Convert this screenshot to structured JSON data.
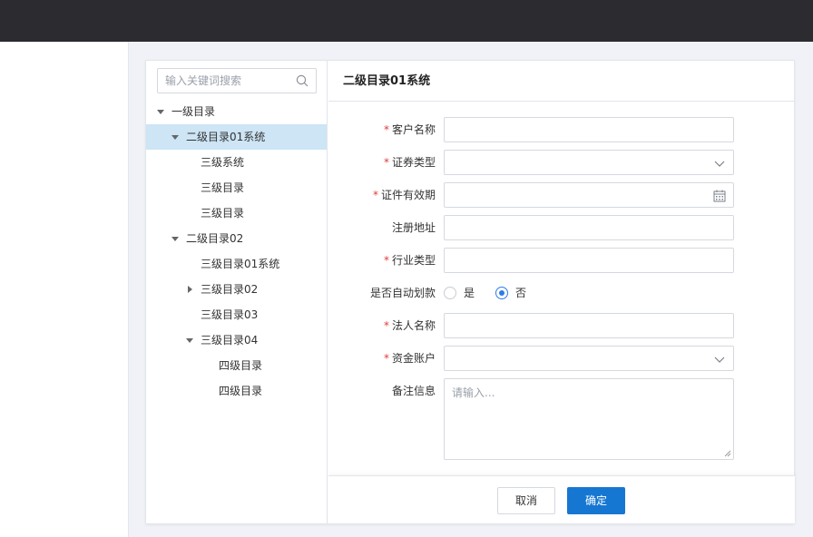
{
  "search": {
    "placeholder": "输入关键词搜索"
  },
  "tree": {
    "n0": "一级目录",
    "n1": "二级目录01系统",
    "n2": "三级系统",
    "n3": "三级目录",
    "n4": "三级目录",
    "n5": "二级目录02",
    "n6": "三级目录01系统",
    "n7": "三级目录02",
    "n8": "三级目录03",
    "n9": "三级目录04",
    "n10": "四级目录",
    "n11": "四级目录"
  },
  "form": {
    "title": "二级目录01系统",
    "required_mark": "*",
    "labels": {
      "customer_name": "客户名称",
      "cert_type": "证券类型",
      "cert_validity": "证件有效期",
      "reg_address": "注册地址",
      "industry_type": "行业类型",
      "auto_debit": "是否自动划款",
      "legal_name": "法人名称",
      "fund_account": "资金账户",
      "remarks": "备注信息"
    },
    "auto_debit_options": {
      "yes": "是",
      "no": "否"
    },
    "auto_debit_selected": "否",
    "remarks_placeholder": "请输入..."
  },
  "footer": {
    "cancel": "取消",
    "confirm": "确定"
  },
  "colors": {
    "primary": "#1677d2",
    "required": "#e23c39",
    "selected_row": "#cde5f5",
    "topbar": "#2b2b30"
  }
}
